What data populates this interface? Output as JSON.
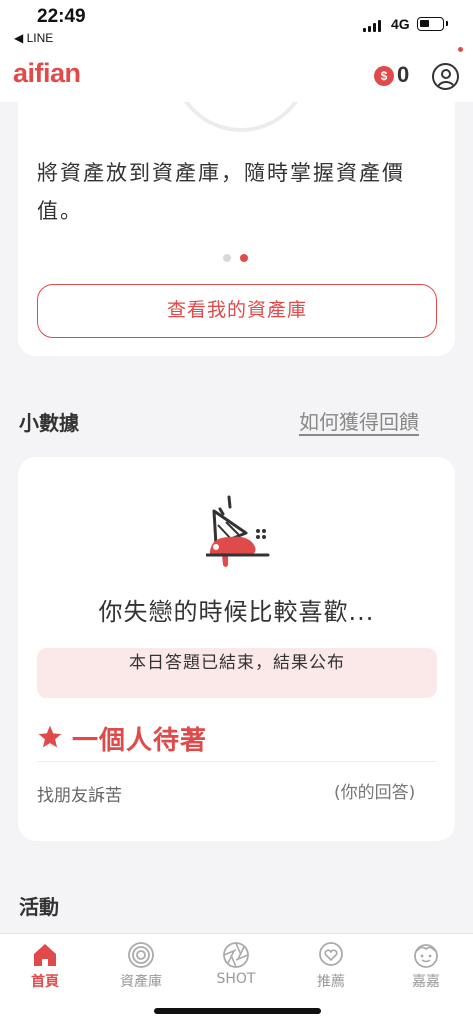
{
  "status_bar": {
    "time": "22:49",
    "back_app": "◀ LINE",
    "network": "4G"
  },
  "header": {
    "logo": "aifian",
    "coin_symbol": "$",
    "coin_count": "0"
  },
  "asset_card": {
    "description": "將資產放到資產庫，隨時掌握資產價值。",
    "carousel_pages": 2,
    "carousel_active": 2,
    "button_label": "查看我的資產庫"
  },
  "data_section": {
    "title": "小數據",
    "link_label": "如何獲得回饋",
    "question": "你失戀的時候比較喜歡...",
    "status_banner": "本日答題已結束，結果公布",
    "top_answer": "一個人待著",
    "my_answer": "找朋友訴苦",
    "my_answer_tag": "(你的回答)"
  },
  "activity_section": {
    "title": "活動"
  },
  "tabs": [
    {
      "label": "首頁",
      "icon": "home-icon",
      "active": true
    },
    {
      "label": "資產庫",
      "icon": "vault-icon",
      "active": false
    },
    {
      "label": "SHOT",
      "icon": "aperture-icon",
      "active": false
    },
    {
      "label": "推薦",
      "icon": "heart-bubble-icon",
      "active": false
    },
    {
      "label": "嘉嘉",
      "icon": "face-icon",
      "active": false
    }
  ],
  "colors": {
    "accent": "#e04a4a",
    "background": "#f4f4f6",
    "banner": "#fbe8e8"
  }
}
